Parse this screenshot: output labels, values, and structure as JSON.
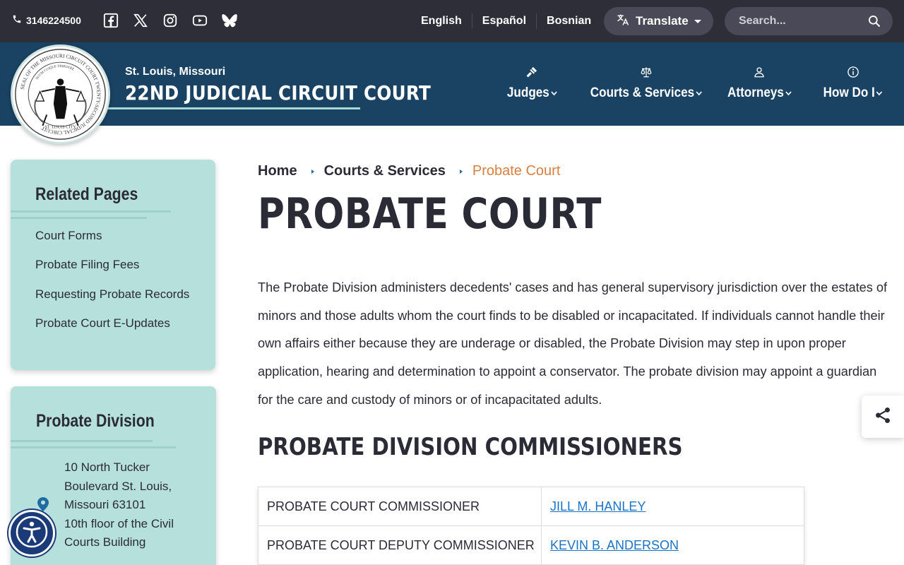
{
  "topbar": {
    "phone": "3146224500",
    "social_icons": [
      "facebook-icon",
      "x-icon",
      "instagram-icon",
      "youtube-icon",
      "bluesky-icon"
    ],
    "languages": [
      "English",
      "Español",
      "Bosnian"
    ],
    "translate_label": "Translate",
    "search_placeholder": "Search..."
  },
  "header": {
    "location": "St. Louis, Missouri",
    "court_name": "22ND JUDICIAL CIRCUIT COURT",
    "seal_text": {
      "outer": "SEAL OF THE MISSOURI CIRCUIT COURT TWENTY-SECOND JUDICIAL CIRCUIT",
      "inner": "SUUM CUIQUE TRIBUERE",
      "bottom": "ST. LOUIS CITY"
    },
    "nav": [
      {
        "label": "Judges",
        "icon": "gavel-icon"
      },
      {
        "label": "Courts & Services",
        "icon": "scales-icon"
      },
      {
        "label": "Attorneys",
        "icon": "person-icon"
      },
      {
        "label": "How Do I",
        "icon": "info-icon"
      }
    ]
  },
  "sidebar": {
    "related": {
      "title": "Related Pages",
      "links": [
        "Court Forms",
        "Probate Filing Fees",
        "Requesting Probate Records",
        "Probate Court E-Updates"
      ]
    },
    "division": {
      "title": "Probate Division",
      "address_lines": [
        "10 North Tucker",
        "Boulevard St. Louis,",
        "Missouri 63101",
        "10th floor of the Civil",
        "Courts Building"
      ]
    }
  },
  "main": {
    "breadcrumb": [
      "Home",
      "Courts & Services",
      "Probate Court"
    ],
    "title": "PROBATE COURT",
    "body": "The Probate Division administers decedents' cases and has general supervisory jurisdiction over the estates of minors and those adults whom the court finds to be disabled or incapacitated. If individuals cannot handle their own affairs either because they are underage or disabled, the Probate Division may step in upon proper application, hearing and determination to appoint a conservator. The probate division may appoint a guardian for the care and custody of minors or of incapacitated adults.",
    "section_title": "PROBATE DIVISION COMMISSIONERS",
    "commissioners": [
      {
        "role": "PROBATE COURT COMMISSIONER",
        "name": "JILL M. HANLEY"
      },
      {
        "role": "PROBATE COURT DEPUTY COMMISSIONER",
        "name": "KEVIN B. ANDERSON"
      }
    ]
  },
  "colors": {
    "topbar": "#2e2e38",
    "header": "#1a4263",
    "sidebar_card": "#b6e0dc",
    "breadcrumb_current": "#d9803f",
    "link": "#1a73c9"
  }
}
